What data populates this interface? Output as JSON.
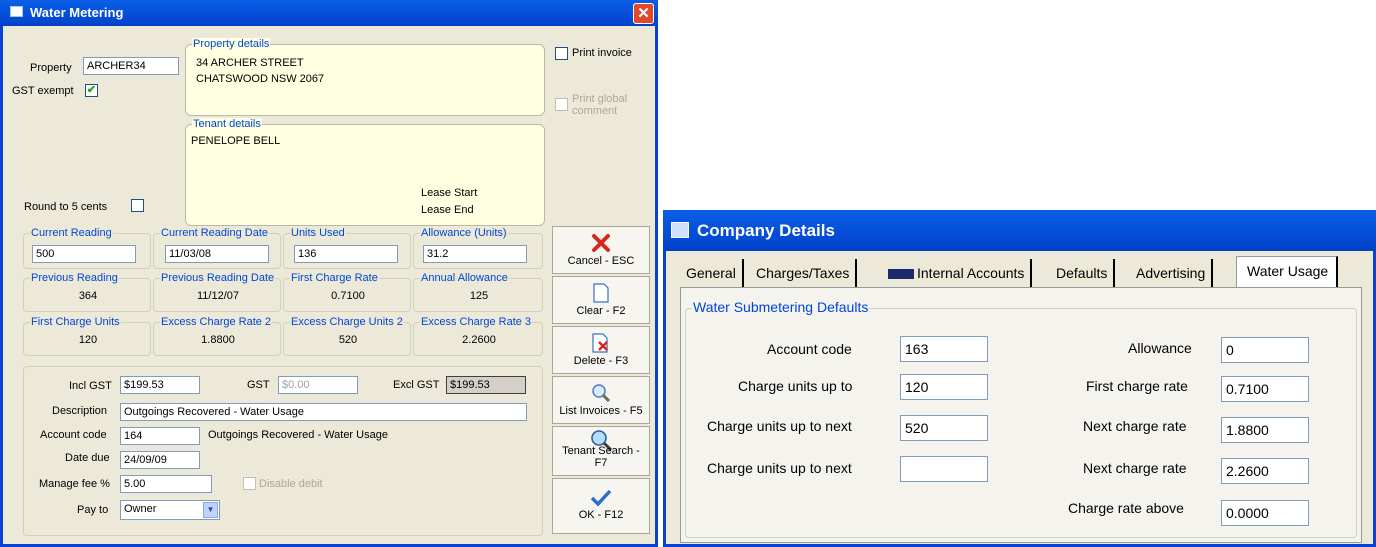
{
  "water": {
    "title": "Water Metering",
    "property_label": "Property",
    "property_value": "ARCHER34",
    "gst_exempt_label": "GST exempt",
    "gst_exempt_check": "✔",
    "round_label": "Round to 5 cents",
    "property_details_title": "Property details",
    "address1": "34 ARCHER STREET",
    "address2": "CHATSWOOD  NSW  2067",
    "print_invoice": "Print invoice",
    "print_global": "Print global",
    "print_global2": "comment",
    "tenant_details_title": "Tenant details",
    "tenant_name": "PENELOPE BELL",
    "lease_start": "Lease Start",
    "lease_end": "Lease End",
    "current_reading_title": "Current Reading",
    "current_reading": "500",
    "current_date_title": "Current Reading Date",
    "current_date": "11/03/08",
    "units_used_title": "Units Used",
    "units_used": "136",
    "allowance_title": "Allowance (Units)",
    "allowance": "31.2",
    "prev_reading_title": "Previous Reading",
    "prev_reading": "364",
    "prev_date_title": "Previous Reading Date",
    "prev_date": "11/12/07",
    "first_rate_title": "First Charge Rate",
    "first_rate": "0.7100",
    "annual_allow_title": "Annual Allowance",
    "annual_allow": "125",
    "first_units_title": "First Charge Units",
    "first_units": "120",
    "excess_rate2_title": "Excess Charge Rate 2",
    "excess_rate2": "1.8800",
    "excess_units2_title": "Excess Charge Units 2",
    "excess_units2": "520",
    "excess_rate3_title": "Excess Charge Rate 3",
    "excess_rate3": "2.2600",
    "incl_gst_label": "Incl GST",
    "incl_gst": "$199.53",
    "gst_label": "GST",
    "gst": "$0.00",
    "excl_gst_label": "Excl GST",
    "excl_gst": "$199.53",
    "description_label": "Description",
    "description": "Outgoings Recovered - Water Usage",
    "account_code_label": "Account code",
    "account_code": "164",
    "account_desc": "Outgoings Recovered - Water Usage",
    "date_due_label": "Date due",
    "date_due": "24/09/09",
    "manage_fee_label": "Manage fee %",
    "manage_fee": "5.00",
    "disable_debit": "Disable debit",
    "pay_to_label": "Pay to",
    "pay_to": "Owner",
    "buttons": {
      "cancel": "Cancel - ESC",
      "clear": "Clear - F2",
      "delete": "Delete - F3",
      "list": "List Invoices - F5",
      "tenant_search": "Tenant Search -",
      "tenant_search2": "F7",
      "ok": "OK - F12"
    }
  },
  "company": {
    "title": "Company Details",
    "tabs": [
      "General",
      "Charges/Taxes",
      "Internal Accounts",
      "Defaults",
      "Advertising",
      "Water Usage"
    ],
    "group_title": "Water Submetering Defaults",
    "account_code_label": "Account code",
    "account_code": "163",
    "units_up_to_label": "Charge units up to",
    "units_up_to": "120",
    "units_next_label": "Charge units up to next",
    "units_next": "520",
    "units_next2_label": "Charge units up to next",
    "units_next2": "",
    "allowance_label": "Allowance",
    "allowance": "0",
    "first_rate_label": "First charge rate",
    "first_rate": "0.7100",
    "next_rate_label": "Next charge rate",
    "next_rate": "1.8800",
    "next_rate2_label": "Next charge rate",
    "next_rate2": "2.2600",
    "above_label": "Charge rate above",
    "above": "0.0000"
  },
  "colors": {
    "titlebar": "#0a5fe8",
    "groupTitle": "#0046d5",
    "yellow": "#ffffe1",
    "dialog": "#ece9d8"
  }
}
